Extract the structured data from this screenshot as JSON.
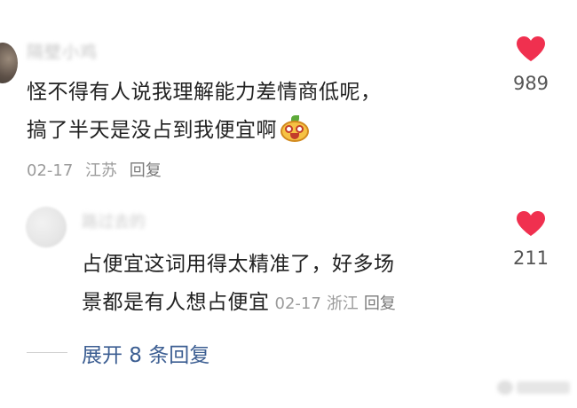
{
  "comment": {
    "username": "隔壁小鸡",
    "text_lines": [
      "怪不得有人说我理解能力差情商低呢，",
      "搞了半天是没占到我便宜啊"
    ],
    "emoji": "smirk-face-emoji",
    "date": "02-17",
    "location": "江苏",
    "reply_label": "回复",
    "likes": "989"
  },
  "reply": {
    "username": "路过去的",
    "text_lines": [
      "占便宜这词用得太精准了，好多场",
      "景都是有人想占便宜"
    ],
    "date": "02-17",
    "location": "浙江",
    "reply_label": "回复",
    "likes": "211"
  },
  "expand": {
    "label": "展开 8 条回复"
  },
  "colors": {
    "heart": "#f0304f",
    "link": "#3c5e92",
    "meta": "#9b9b9b",
    "text": "#222222"
  },
  "icons": {
    "like": "heart-icon"
  }
}
